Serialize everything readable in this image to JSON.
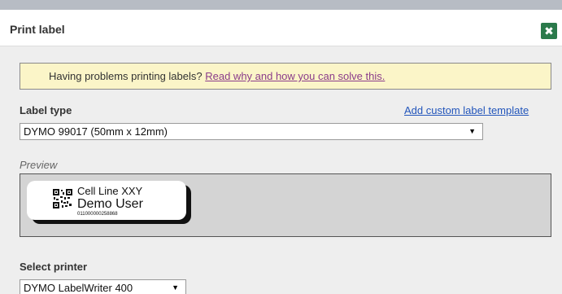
{
  "dialog": {
    "title": "Print label",
    "close_icon": "close-icon"
  },
  "warning": {
    "text": "Having problems printing labels?",
    "link": "Read why and how you can solve this."
  },
  "label_type": {
    "heading": "Label type",
    "custom_link": "Add custom label template",
    "selected": "DYMO 99017 (50mm x 12mm)"
  },
  "preview": {
    "caption": "Preview",
    "line1": "Cell Line XXY",
    "line2": "Demo User",
    "line3": "011000000258868",
    "qr_icon": "qr-code-icon"
  },
  "printer": {
    "heading": "Select printer",
    "selected": "DYMO LabelWriter 400"
  },
  "colors": {
    "close_button": "#2b7a4b",
    "warning_bg": "#fbf5c8",
    "link_blue": "#2255bb",
    "link_purple": "#8a3c8a"
  }
}
